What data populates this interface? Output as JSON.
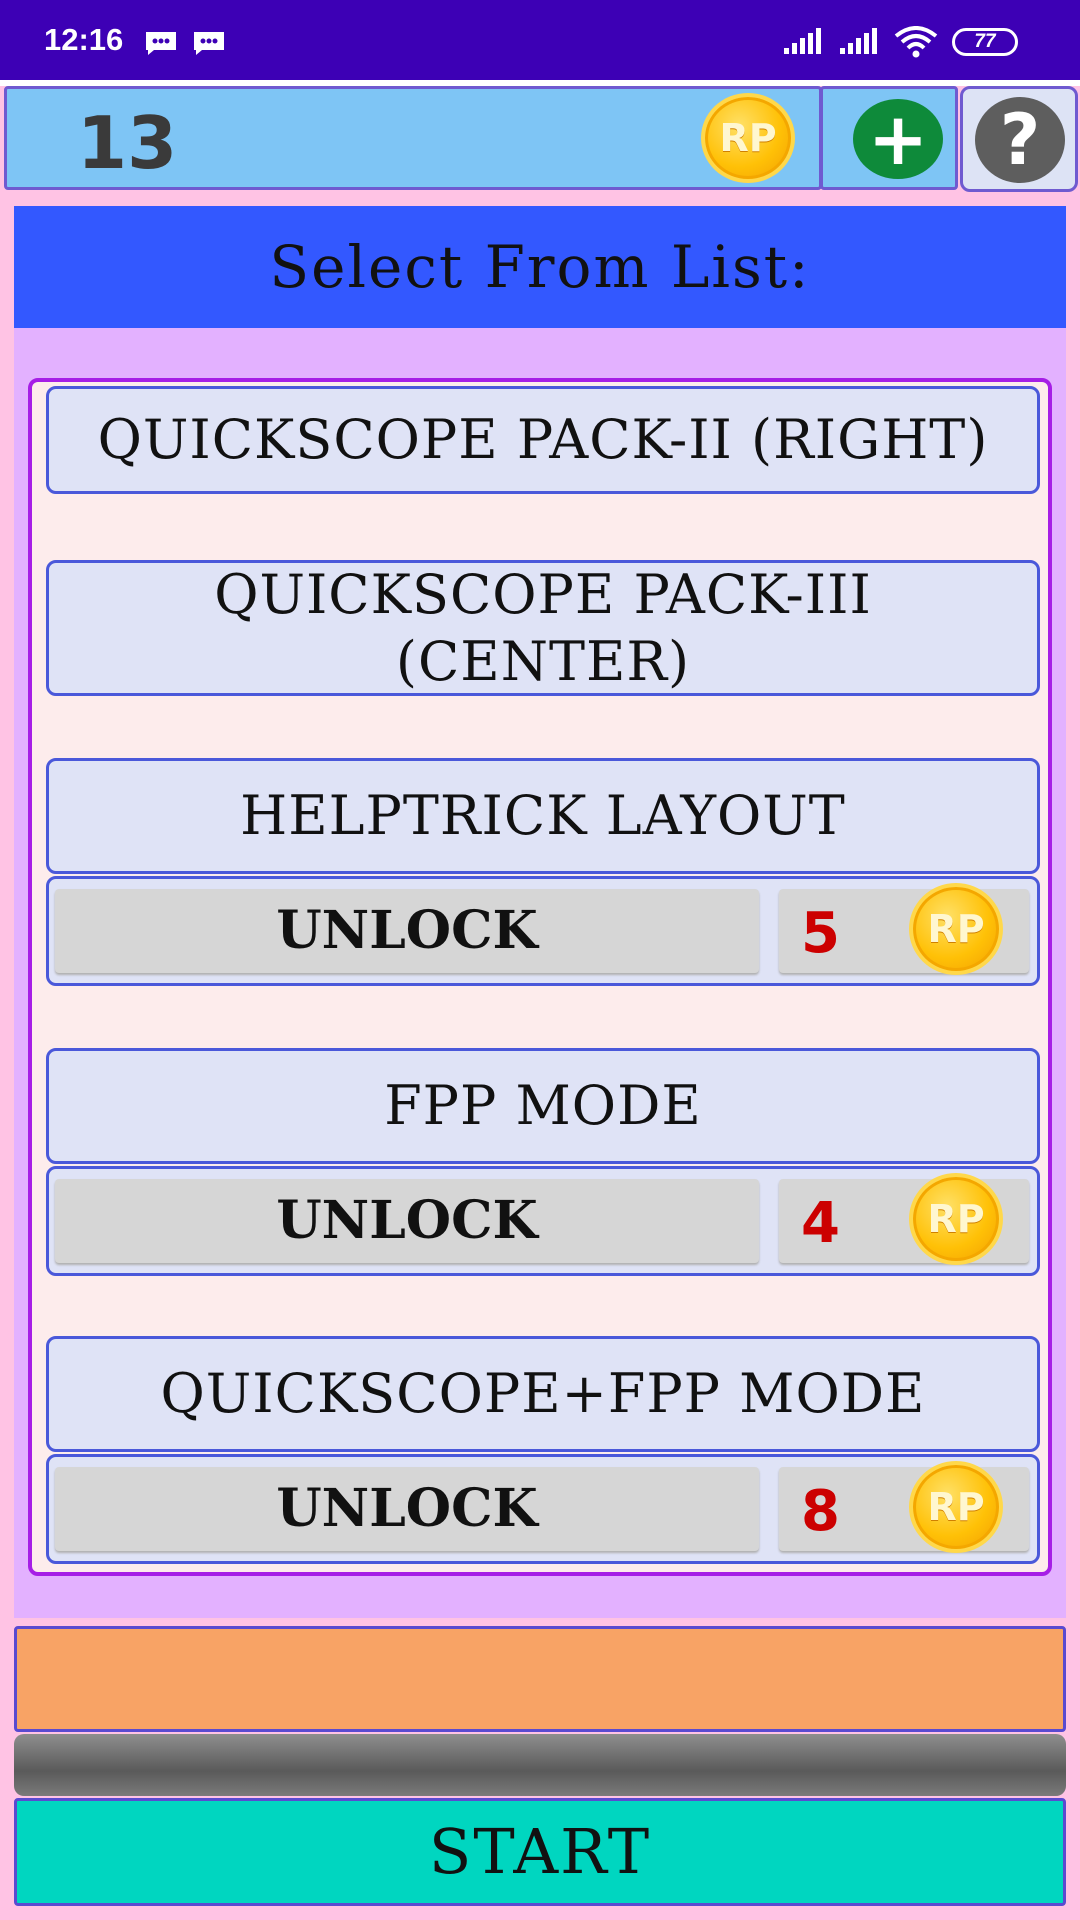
{
  "status_bar": {
    "time": "12:16",
    "battery": "77",
    "icons": [
      "message-icon",
      "message-icon",
      "signal-icon",
      "signal-icon",
      "wifi-icon",
      "battery-icon"
    ]
  },
  "header": {
    "points": "13",
    "coin_label": "RP",
    "add_icon": "plus-icon",
    "help_icon": "question-icon"
  },
  "title": "Select From List:",
  "list": {
    "items": [
      {
        "label": "QUICKSCOPE PACK-II (RIGHT)"
      },
      {
        "label": "QUICKSCOPE PACK-III (CENTER)"
      },
      {
        "label": "HELPTRICK LAYOUT",
        "unlock_label": "UNLOCK",
        "cost": "5"
      },
      {
        "label": "FPP MODE",
        "unlock_label": "UNLOCK",
        "cost": "4"
      },
      {
        "label": "QUICKSCOPE+FPP MODE",
        "unlock_label": "UNLOCK",
        "cost": "8"
      }
    ]
  },
  "footer": {
    "start_label": "START"
  },
  "colors": {
    "status_bar": "#3d00b5",
    "title_bar": "#3358ff",
    "panel": "#e3b1ff",
    "cost_text": "#cc0000",
    "start_button": "#00d6c0",
    "orange_bar": "#f8a365"
  }
}
